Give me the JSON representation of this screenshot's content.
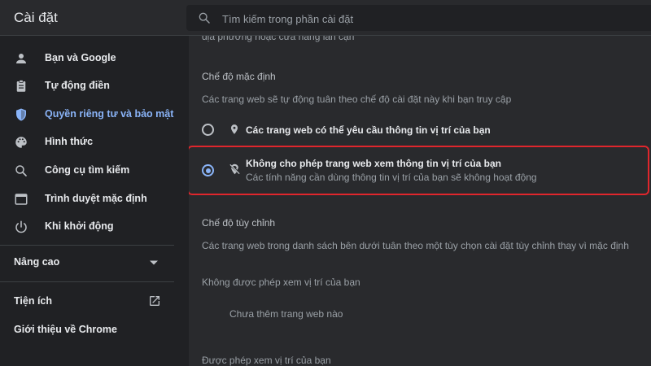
{
  "header": {
    "title": "Cài đặt",
    "search_placeholder": "Tìm kiếm trong phần cài đặt",
    "search_icon": "search-icon"
  },
  "sidebar": {
    "items": [
      {
        "label": "Bạn và Google",
        "icon": "person-icon"
      },
      {
        "label": "Tự động điền",
        "icon": "clipboard-icon"
      },
      {
        "label": "Quyền riêng tư và bảo mật",
        "icon": "shield-icon",
        "active": true
      },
      {
        "label": "Hình thức",
        "icon": "palette-icon"
      },
      {
        "label": "Công cụ tìm kiếm",
        "icon": "search-icon"
      },
      {
        "label": "Trình duyệt mặc định",
        "icon": "browser-icon"
      },
      {
        "label": "Khi khởi động",
        "icon": "power-icon"
      }
    ],
    "advanced": {
      "label": "Nâng cao",
      "icon": "chevron-down-icon"
    },
    "extensions": {
      "label": "Tiện ích",
      "icon": "open-in-new-icon"
    },
    "about": {
      "label": "Giới thiệu về Chrome"
    }
  },
  "content": {
    "top_cut_text": "địa phương hoặc cửa hàng lân cận",
    "default_mode": {
      "heading": "Chế độ mặc định",
      "description": "Các trang web sẽ tự động tuân theo chế độ cài đặt này khi bạn truy cập",
      "options": [
        {
          "label": "Các trang web có thể yêu cầu thông tin vị trí của bạn",
          "sublabel": "",
          "icon": "location-pin-icon",
          "selected": false
        },
        {
          "label": "Không cho phép trang web xem thông tin vị trí của bạn",
          "sublabel": "Các tính năng cần dùng thông tin vị trí của bạn sẽ không hoạt động",
          "icon": "location-off-icon",
          "selected": true
        }
      ]
    },
    "custom_mode": {
      "heading": "Chế độ tùy chỉnh",
      "description": "Các trang web trong danh sách bên dưới tuân theo một tùy chọn cài đặt tùy chỉnh thay vì mặc định"
    },
    "blocked": {
      "heading": "Không được phép xem vị trí của bạn",
      "empty": "Chưa thêm trang web nào"
    },
    "allowed": {
      "heading": "Được phép xem vị trí của bạn"
    }
  },
  "colors": {
    "accent": "#8ab4f8",
    "highlight_border": "#e0262c",
    "background": "#202124",
    "card": "#292a2d"
  }
}
